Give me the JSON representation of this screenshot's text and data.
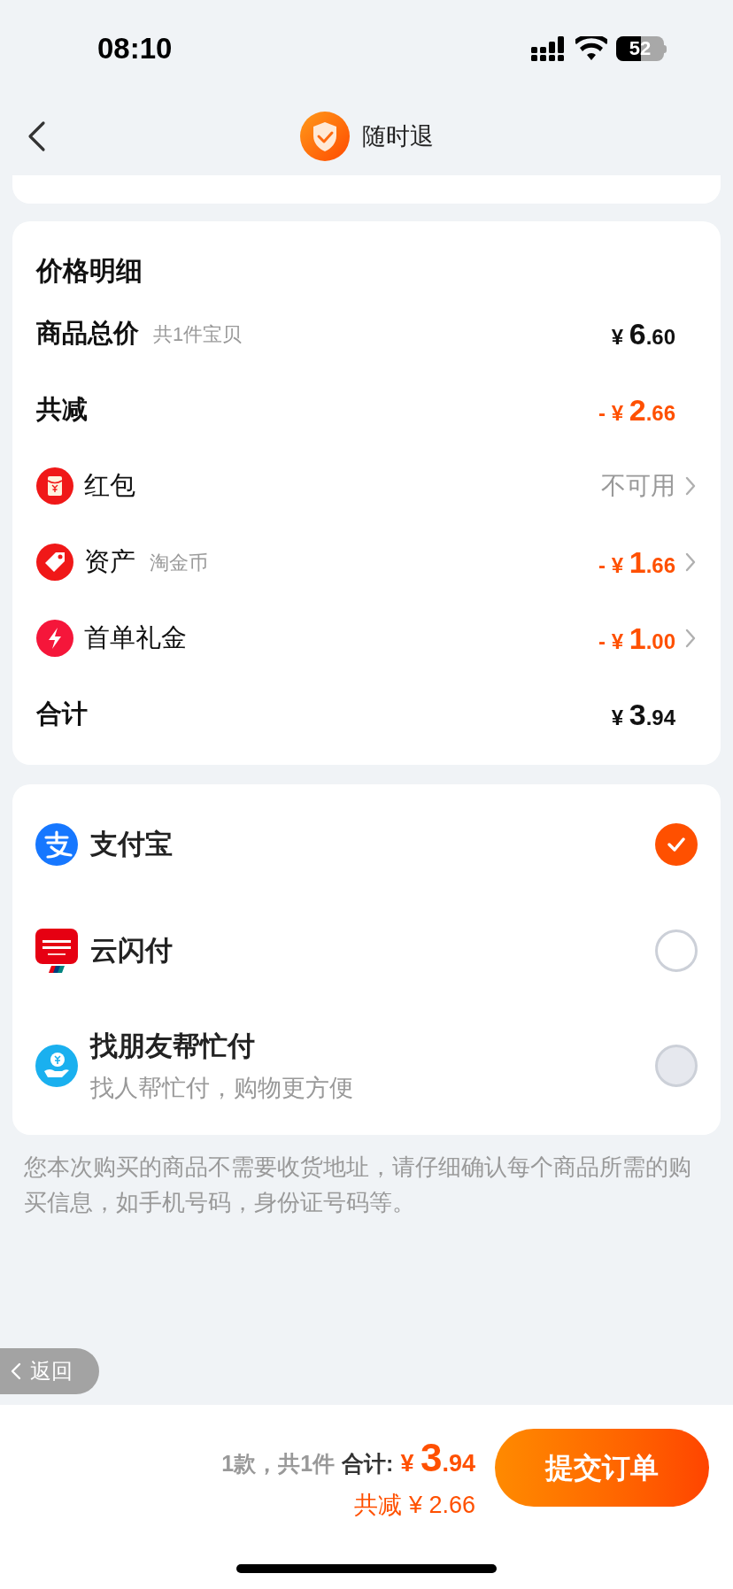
{
  "status_bar": {
    "time": "08:10",
    "battery": "52"
  },
  "nav": {
    "title": "随时退"
  },
  "price_details": {
    "title": "价格明细",
    "rows": [
      {
        "kind": "plain",
        "label": "商品总价",
        "note": "共1件宝贝",
        "value": "¥ 6.60"
      },
      {
        "kind": "discount",
        "label": "共减",
        "value": "- ¥ 2.66"
      },
      {
        "kind": "link-muted",
        "label": "红包",
        "value": "不可用"
      },
      {
        "kind": "link-discount",
        "label": "资产",
        "note": "淘金币",
        "value": "- ¥ 1.66"
      },
      {
        "kind": "link-discount",
        "label": "首单礼金",
        "value": "- ¥ 1.00"
      },
      {
        "kind": "plain",
        "label": "合计",
        "value": "¥ 3.94"
      }
    ]
  },
  "payment_methods": [
    {
      "name": "支付宝",
      "selected": true,
      "disabled": false
    },
    {
      "name": "云闪付",
      "selected": false,
      "disabled": false
    },
    {
      "name": "找朋友帮忙付",
      "subtitle": "找人帮忙付，购物更方便",
      "selected": false,
      "disabled": true
    }
  ],
  "notice": "您本次购买的商品不需要收货地址，请仔细确认每个商品所需的购买信息，如手机号码，身份证号码等。",
  "back_pill": {
    "label": "返回"
  },
  "footer": {
    "count": "1款，共1件",
    "total_label": "合计:",
    "total": "¥ 3.94",
    "saved": "共减 ¥ 2.66",
    "submit": "提交订单"
  }
}
